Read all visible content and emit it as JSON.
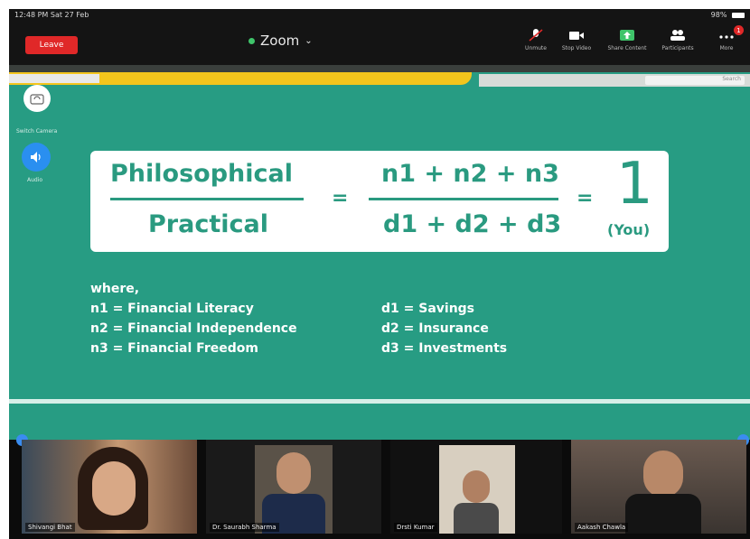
{
  "status": {
    "time": "12:48 PM  Sat 27 Feb",
    "right": "98%"
  },
  "toolbar": {
    "leave_label": "Leave",
    "app_title": "Zoom",
    "items": [
      {
        "label": "Unmute",
        "icon": "microphone-muted-icon"
      },
      {
        "label": "Stop Video",
        "icon": "video-camera-icon"
      },
      {
        "label": "Share Content",
        "icon": "share-screen-icon"
      },
      {
        "label": "Participants",
        "icon": "participants-icon"
      },
      {
        "label": "More",
        "icon": "more-icon"
      }
    ],
    "more_badge": "1"
  },
  "side_controls": {
    "camera_label": "Switch Camera",
    "audio_label": "Audio"
  },
  "shared_window": {
    "browser_search": "Search"
  },
  "slide": {
    "numerator_left": "Philosophical",
    "denominator_left": "Practical",
    "equals": "=",
    "numerator_right": "n1 + n2 + n3",
    "denominator_right": "d1 + d2 + d3",
    "result": "1",
    "result_note": "(You)",
    "where": "where,",
    "definitions_left": [
      "n1 = Financial Literacy",
      "n2 = Financial Independence",
      "n3 = Financial Freedom"
    ],
    "definitions_right": [
      "d1 = Savings",
      "d2 = Insurance",
      "d3 = Investments"
    ]
  },
  "participants": [
    {
      "name": "Shivangi Bhat"
    },
    {
      "name": "Dr. Saurabh Sharma"
    },
    {
      "name": "Drsti Kumar"
    },
    {
      "name": "Aakash Chawla"
    }
  ],
  "colors": {
    "slide_bg": "#279c83",
    "accent_yellow": "#f3c51c",
    "leave_red": "#e02828"
  }
}
